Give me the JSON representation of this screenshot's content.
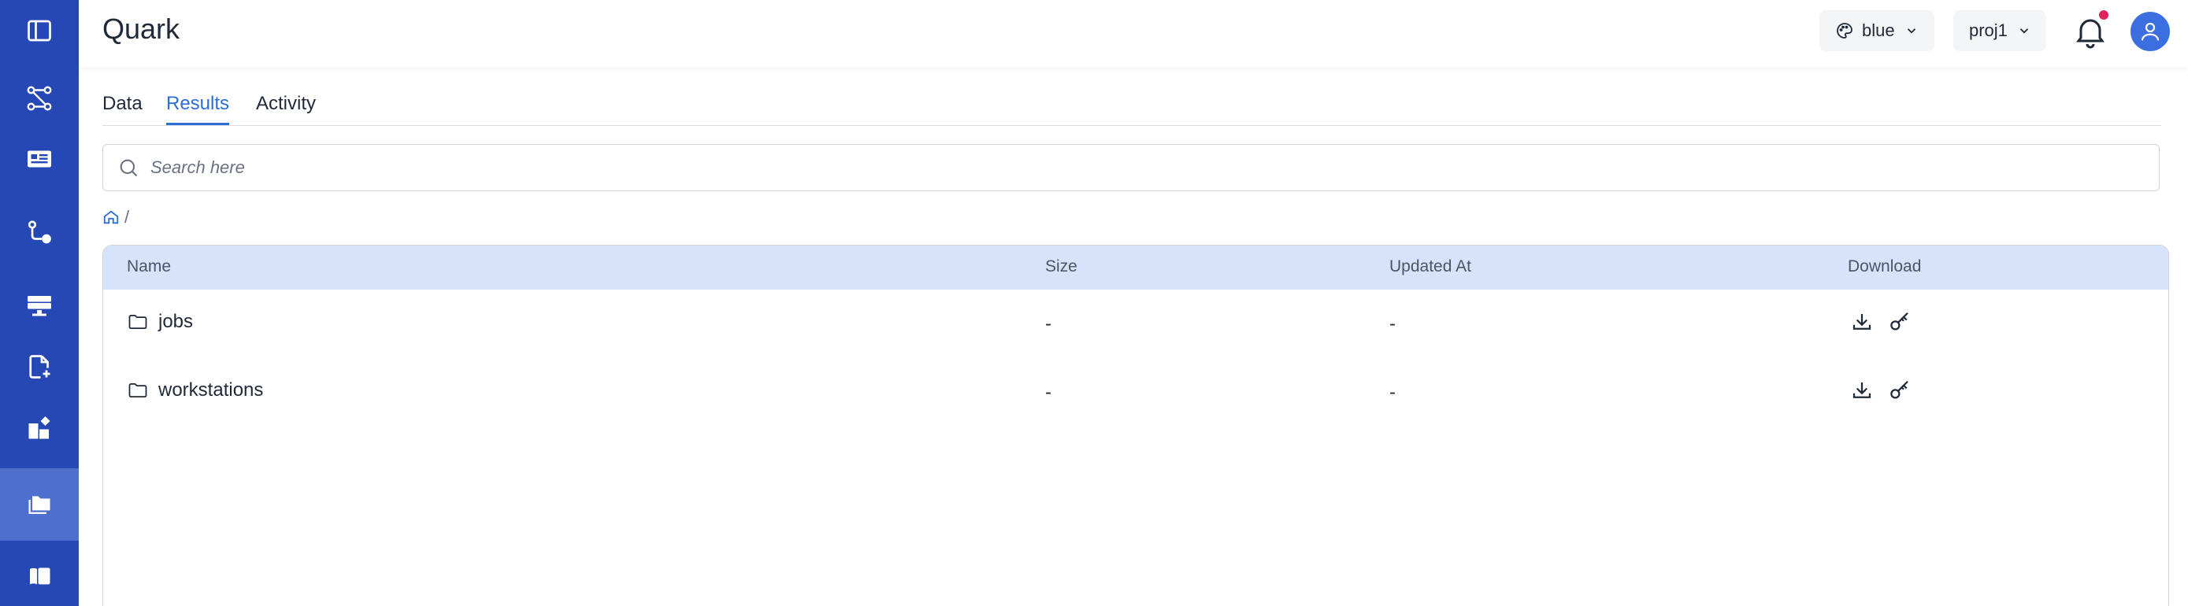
{
  "app": {
    "title": "Quark"
  },
  "header": {
    "theme_selector": {
      "value": "blue",
      "icon": "palette-icon"
    },
    "project_selector": {
      "value": "proj1"
    },
    "notifications_icon": "bell-icon",
    "user_icon": "user-icon",
    "colors": {
      "accent": "#2b6fd6",
      "sidebar": "#2548b5",
      "sidebar_active": "#4f6fcf",
      "table_header": "#d6e3fb",
      "notification_dot": "#e0245e",
      "avatar": "#3b6fe0"
    }
  },
  "sidebar": {
    "items": [
      {
        "icon": "panel-toggle-icon",
        "active": false
      },
      {
        "icon": "workflow-icon",
        "active": false
      },
      {
        "icon": "dashboard-icon",
        "active": false
      },
      {
        "icon": "pipeline-icon",
        "active": false
      },
      {
        "icon": "workstation-icon",
        "active": false
      },
      {
        "icon": "new-file-icon",
        "active": false
      },
      {
        "icon": "apps-icon",
        "active": false
      },
      {
        "icon": "folders-icon",
        "active": true
      },
      {
        "icon": "docs-icon",
        "active": false
      }
    ]
  },
  "tabs": [
    {
      "label": "Data",
      "active": false
    },
    {
      "label": "Results",
      "active": true
    },
    {
      "label": "Activity",
      "active": false
    }
  ],
  "search": {
    "placeholder": "Search here",
    "value": ""
  },
  "breadcrumb": {
    "root_icon": "home-icon",
    "separator": "/"
  },
  "table": {
    "columns": [
      "Name",
      "Size",
      "Updated At",
      "Download"
    ],
    "rows": [
      {
        "name": "jobs",
        "size": "-",
        "updated_at": "-",
        "type": "folder"
      },
      {
        "name": "workstations",
        "size": "-",
        "updated_at": "-",
        "type": "folder"
      }
    ]
  }
}
